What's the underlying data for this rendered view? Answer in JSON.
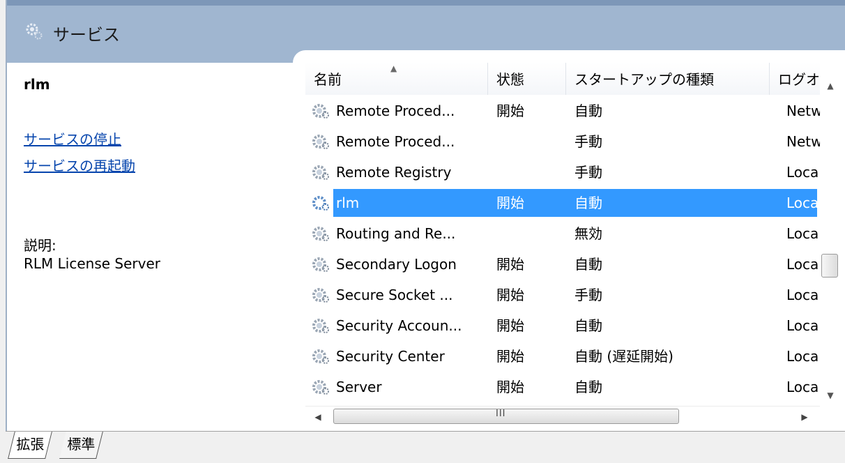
{
  "header": {
    "title": "サービス"
  },
  "details": {
    "selected_name": "rlm",
    "actions": {
      "stop": "サービスの停止",
      "restart": "サービスの再起動"
    },
    "description_label": "説明:",
    "description": "RLM License Server"
  },
  "table": {
    "columns": {
      "name": "名前",
      "status": "状態",
      "startup": "スタートアップの種類",
      "logon": "ログオ"
    },
    "rows": [
      {
        "name": "Remote Proced...",
        "status": "開始",
        "startup": "自動",
        "logon": "Netw"
      },
      {
        "name": "Remote Proced...",
        "status": "",
        "startup": "手動",
        "logon": "Netw"
      },
      {
        "name": "Remote Registry",
        "status": "",
        "startup": "手動",
        "logon": "Loca"
      },
      {
        "name": "rlm",
        "status": "開始",
        "startup": "自動",
        "logon": "Loca",
        "selected": true
      },
      {
        "name": "Routing and Re...",
        "status": "",
        "startup": "無効",
        "logon": "Loca"
      },
      {
        "name": "Secondary Logon",
        "status": "開始",
        "startup": "自動",
        "logon": "Loca"
      },
      {
        "name": "Secure Socket ...",
        "status": "開始",
        "startup": "手動",
        "logon": "Loca"
      },
      {
        "name": "Security Accoun...",
        "status": "開始",
        "startup": "自動",
        "logon": "Loca"
      },
      {
        "name": "Security Center",
        "status": "開始",
        "startup": "自動 (遅延開始)",
        "logon": "Loca"
      },
      {
        "name": "Server",
        "status": "開始",
        "startup": "自動",
        "logon": "Loca"
      }
    ]
  },
  "scroll": {
    "h_grip": "III"
  },
  "tabs": {
    "extended": "拡張",
    "standard": "標準"
  },
  "icons": {
    "header": "services-gear-icon",
    "row": "service-gear-icon"
  },
  "colors": {
    "header_bg": "#a0b6d0",
    "selection": "#3399ff",
    "link": "#0645ad"
  }
}
